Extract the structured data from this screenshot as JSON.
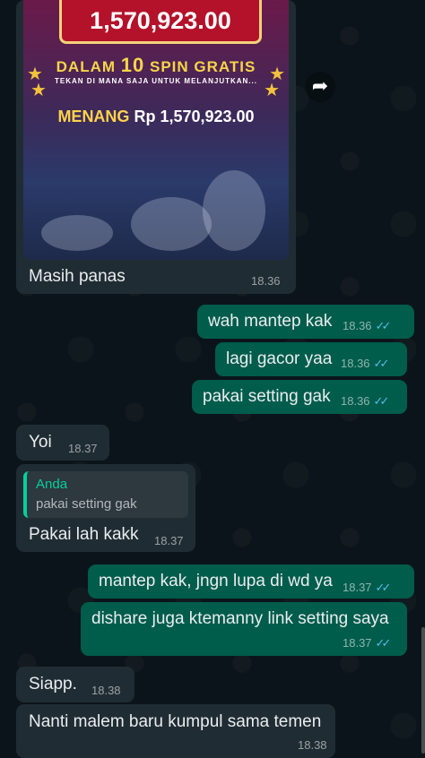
{
  "image_message": {
    "game_amount": "1,570,923.00",
    "spin_prefix": "DALAM",
    "spin_number": "10",
    "spin_suffix": "SPIN GRATIS",
    "tap_text": "TEKAN DI MANA SAJA UNTUK MELANJUTKAN...",
    "menang_label": "MENANG",
    "menang_value": "Rp 1,570,923.00",
    "caption": "Masih panas",
    "time": "18.36"
  },
  "messages": [
    {
      "dir": "out",
      "text": "wah mantep kak",
      "time": "18.36"
    },
    {
      "dir": "out",
      "text": "lagi gacor yaa",
      "time": "18.36"
    },
    {
      "dir": "out",
      "text": "pakai setting gak",
      "time": "18.36"
    },
    {
      "dir": "in",
      "text": "Yoi",
      "time": "18.37"
    },
    {
      "dir": "in",
      "text": "Pakai lah kakk",
      "time": "18.37",
      "quote": {
        "name": "Anda",
        "text": "pakai setting gak"
      }
    },
    {
      "dir": "out",
      "text": "mantep kak, jngn lupa di wd ya",
      "time": "18.37"
    },
    {
      "dir": "out",
      "text": "dishare juga ktemanny link setting saya",
      "time": "18.37"
    },
    {
      "dir": "in",
      "text": "Siapp.",
      "time": "18.38"
    },
    {
      "dir": "in",
      "text": "Nanti malem baru kumpul sama temen",
      "time": "18.38"
    }
  ],
  "icons": {
    "read_ticks": "double-check-icon",
    "forward": "forward-arrow-icon"
  },
  "colors": {
    "incoming": "#202c33",
    "outgoing": "#005c4b",
    "read_ticks": "#53bdeb",
    "background": "#0b141a"
  }
}
